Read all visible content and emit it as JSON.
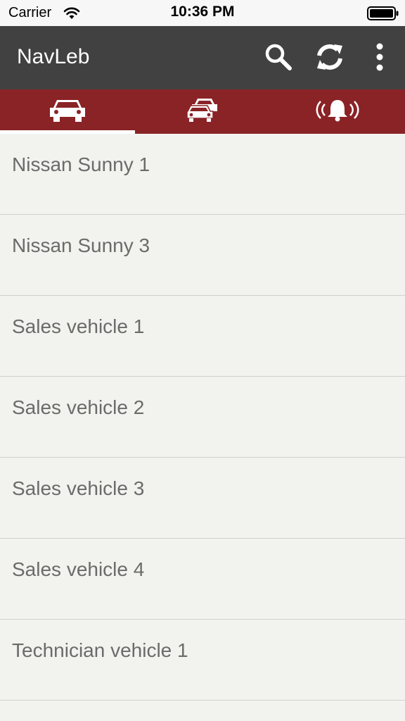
{
  "status_bar": {
    "carrier": "Carrier",
    "time": "10:36 PM",
    "icons": [
      "wifi-icon",
      "battery-icon"
    ]
  },
  "app_bar": {
    "title": "NavLeb",
    "actions": [
      {
        "name": "search",
        "icon": "search-icon"
      },
      {
        "name": "refresh",
        "icon": "refresh-icon"
      },
      {
        "name": "more",
        "icon": "more-vertical-icon"
      }
    ],
    "background": "#414141"
  },
  "tabs": {
    "items": [
      {
        "name": "vehicle",
        "icon": "car-icon",
        "selected": true
      },
      {
        "name": "fleet",
        "icon": "cars-icon",
        "selected": false
      },
      {
        "name": "alerts",
        "icon": "alarm-bell-icon",
        "selected": false
      }
    ],
    "background": "#8a2326",
    "indicator_color": "#ffffff"
  },
  "vehicles": {
    "items": [
      {
        "label": "Nissan Sunny 1"
      },
      {
        "label": "Nissan Sunny 3"
      },
      {
        "label": "Sales vehicle 1"
      },
      {
        "label": "Sales vehicle 2"
      },
      {
        "label": "Sales vehicle 3"
      },
      {
        "label": "Sales vehicle 4"
      },
      {
        "label": "Technician vehicle 1"
      }
    ]
  }
}
